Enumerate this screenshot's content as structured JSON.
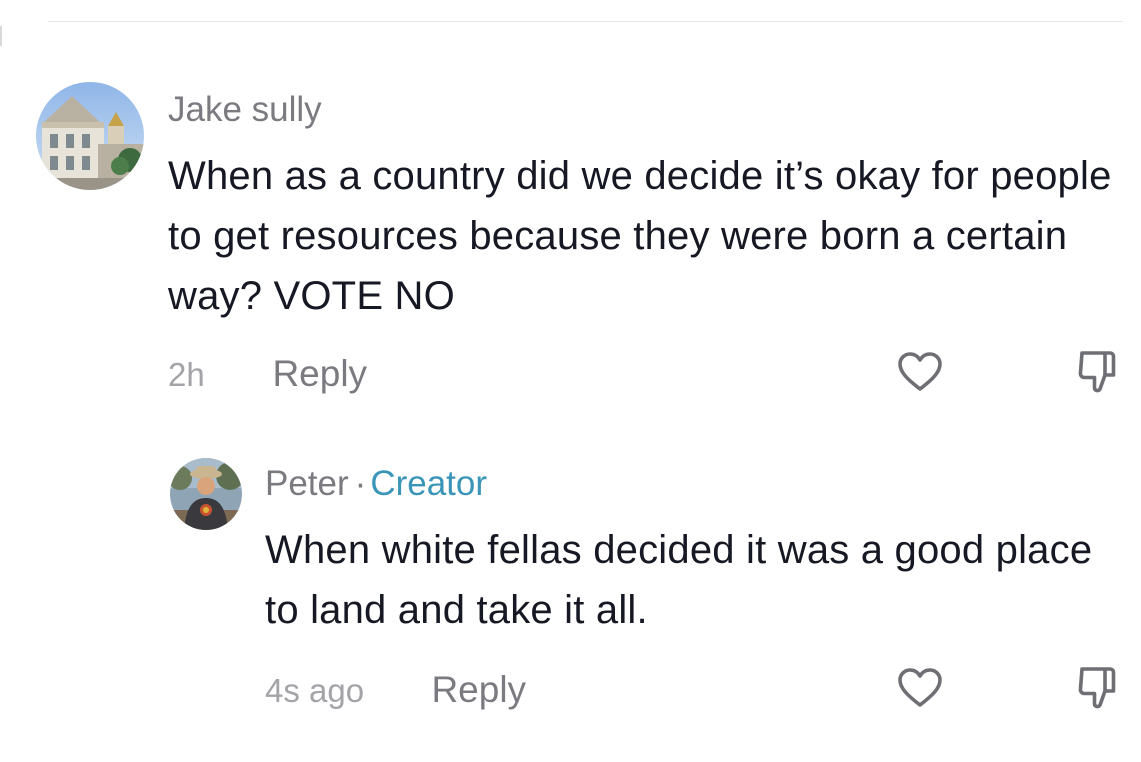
{
  "comments": [
    {
      "username": "Jake sully",
      "text": "When as a country did we decide it’s okay for people to get resources because they were born a certain way? VOTE NO",
      "time": "2h",
      "reply_label": "Reply",
      "avatar_icon": "building-photo-avatar",
      "like_icon": "heart-outline-icon",
      "dislike_icon": "thumbs-down-icon"
    },
    {
      "username": "Peter",
      "separator": "·",
      "badge": "Creator",
      "text": "When white fellas decided it was a good place to land and take it all.",
      "time": "4s ago",
      "reply_label": "Reply",
      "avatar_icon": "person-photo-avatar",
      "like_icon": "heart-outline-icon",
      "dislike_icon": "thumbs-down-icon"
    }
  ],
  "colors": {
    "text_primary": "#161823",
    "text_secondary": "#7a7a80",
    "text_muted": "#a3a3a8",
    "creator_badge": "#3a95b8"
  }
}
